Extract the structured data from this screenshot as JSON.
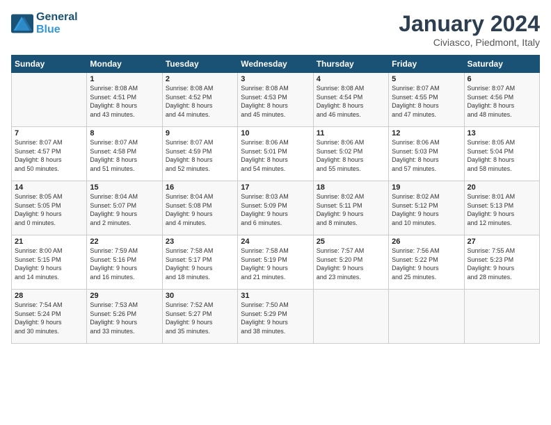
{
  "header": {
    "logo_line1": "General",
    "logo_line2": "Blue",
    "month": "January 2024",
    "location": "Civiasco, Piedmont, Italy"
  },
  "days_of_week": [
    "Sunday",
    "Monday",
    "Tuesday",
    "Wednesday",
    "Thursday",
    "Friday",
    "Saturday"
  ],
  "weeks": [
    [
      {
        "day": "",
        "info": ""
      },
      {
        "day": "1",
        "info": "Sunrise: 8:08 AM\nSunset: 4:51 PM\nDaylight: 8 hours\nand 43 minutes."
      },
      {
        "day": "2",
        "info": "Sunrise: 8:08 AM\nSunset: 4:52 PM\nDaylight: 8 hours\nand 44 minutes."
      },
      {
        "day": "3",
        "info": "Sunrise: 8:08 AM\nSunset: 4:53 PM\nDaylight: 8 hours\nand 45 minutes."
      },
      {
        "day": "4",
        "info": "Sunrise: 8:08 AM\nSunset: 4:54 PM\nDaylight: 8 hours\nand 46 minutes."
      },
      {
        "day": "5",
        "info": "Sunrise: 8:07 AM\nSunset: 4:55 PM\nDaylight: 8 hours\nand 47 minutes."
      },
      {
        "day": "6",
        "info": "Sunrise: 8:07 AM\nSunset: 4:56 PM\nDaylight: 8 hours\nand 48 minutes."
      }
    ],
    [
      {
        "day": "7",
        "info": "Sunrise: 8:07 AM\nSunset: 4:57 PM\nDaylight: 8 hours\nand 50 minutes."
      },
      {
        "day": "8",
        "info": "Sunrise: 8:07 AM\nSunset: 4:58 PM\nDaylight: 8 hours\nand 51 minutes."
      },
      {
        "day": "9",
        "info": "Sunrise: 8:07 AM\nSunset: 4:59 PM\nDaylight: 8 hours\nand 52 minutes."
      },
      {
        "day": "10",
        "info": "Sunrise: 8:06 AM\nSunset: 5:01 PM\nDaylight: 8 hours\nand 54 minutes."
      },
      {
        "day": "11",
        "info": "Sunrise: 8:06 AM\nSunset: 5:02 PM\nDaylight: 8 hours\nand 55 minutes."
      },
      {
        "day": "12",
        "info": "Sunrise: 8:06 AM\nSunset: 5:03 PM\nDaylight: 8 hours\nand 57 minutes."
      },
      {
        "day": "13",
        "info": "Sunrise: 8:05 AM\nSunset: 5:04 PM\nDaylight: 8 hours\nand 58 minutes."
      }
    ],
    [
      {
        "day": "14",
        "info": "Sunrise: 8:05 AM\nSunset: 5:05 PM\nDaylight: 9 hours\nand 0 minutes."
      },
      {
        "day": "15",
        "info": "Sunrise: 8:04 AM\nSunset: 5:07 PM\nDaylight: 9 hours\nand 2 minutes."
      },
      {
        "day": "16",
        "info": "Sunrise: 8:04 AM\nSunset: 5:08 PM\nDaylight: 9 hours\nand 4 minutes."
      },
      {
        "day": "17",
        "info": "Sunrise: 8:03 AM\nSunset: 5:09 PM\nDaylight: 9 hours\nand 6 minutes."
      },
      {
        "day": "18",
        "info": "Sunrise: 8:02 AM\nSunset: 5:11 PM\nDaylight: 9 hours\nand 8 minutes."
      },
      {
        "day": "19",
        "info": "Sunrise: 8:02 AM\nSunset: 5:12 PM\nDaylight: 9 hours\nand 10 minutes."
      },
      {
        "day": "20",
        "info": "Sunrise: 8:01 AM\nSunset: 5:13 PM\nDaylight: 9 hours\nand 12 minutes."
      }
    ],
    [
      {
        "day": "21",
        "info": "Sunrise: 8:00 AM\nSunset: 5:15 PM\nDaylight: 9 hours\nand 14 minutes."
      },
      {
        "day": "22",
        "info": "Sunrise: 7:59 AM\nSunset: 5:16 PM\nDaylight: 9 hours\nand 16 minutes."
      },
      {
        "day": "23",
        "info": "Sunrise: 7:58 AM\nSunset: 5:17 PM\nDaylight: 9 hours\nand 18 minutes."
      },
      {
        "day": "24",
        "info": "Sunrise: 7:58 AM\nSunset: 5:19 PM\nDaylight: 9 hours\nand 21 minutes."
      },
      {
        "day": "25",
        "info": "Sunrise: 7:57 AM\nSunset: 5:20 PM\nDaylight: 9 hours\nand 23 minutes."
      },
      {
        "day": "26",
        "info": "Sunrise: 7:56 AM\nSunset: 5:22 PM\nDaylight: 9 hours\nand 25 minutes."
      },
      {
        "day": "27",
        "info": "Sunrise: 7:55 AM\nSunset: 5:23 PM\nDaylight: 9 hours\nand 28 minutes."
      }
    ],
    [
      {
        "day": "28",
        "info": "Sunrise: 7:54 AM\nSunset: 5:24 PM\nDaylight: 9 hours\nand 30 minutes."
      },
      {
        "day": "29",
        "info": "Sunrise: 7:53 AM\nSunset: 5:26 PM\nDaylight: 9 hours\nand 33 minutes."
      },
      {
        "day": "30",
        "info": "Sunrise: 7:52 AM\nSunset: 5:27 PM\nDaylight: 9 hours\nand 35 minutes."
      },
      {
        "day": "31",
        "info": "Sunrise: 7:50 AM\nSunset: 5:29 PM\nDaylight: 9 hours\nand 38 minutes."
      },
      {
        "day": "",
        "info": ""
      },
      {
        "day": "",
        "info": ""
      },
      {
        "day": "",
        "info": ""
      }
    ]
  ]
}
